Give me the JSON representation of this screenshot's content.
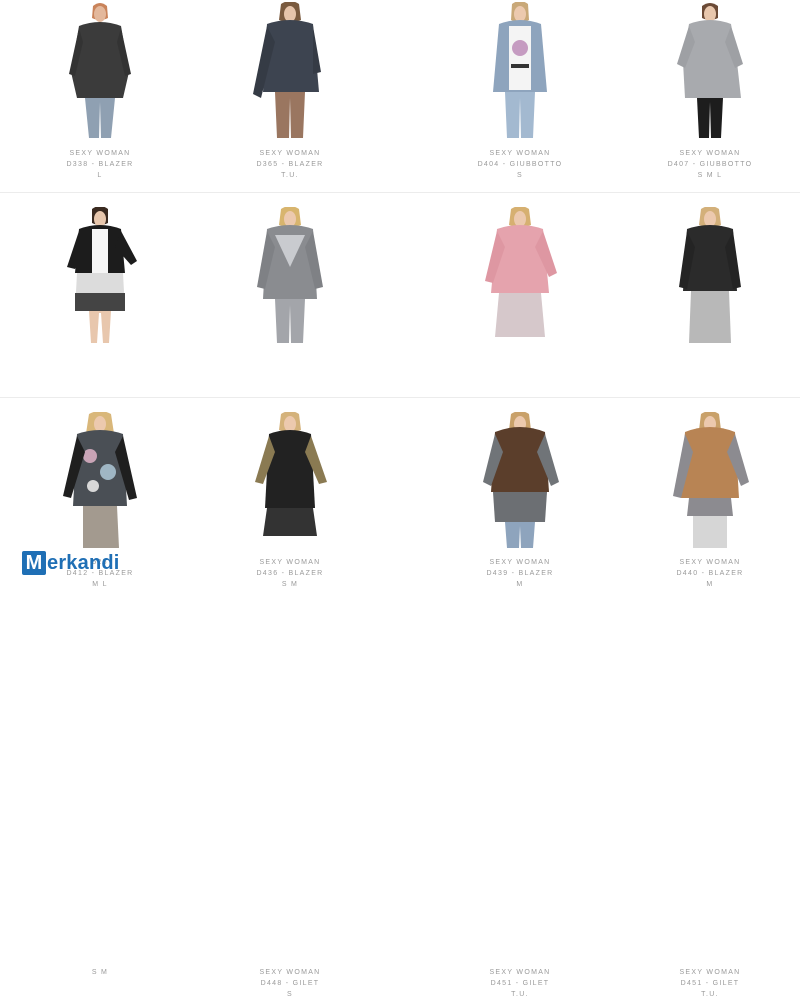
{
  "watermark": {
    "brand": "Merkandi"
  },
  "products": [
    {
      "brand": "SEXY WOMAN",
      "code": "D338 - BLAZER",
      "sizes": "L"
    },
    {
      "brand": "SEXY WOMAN",
      "code": "D365 - BLAZER",
      "sizes": "T.U."
    },
    {
      "brand": "SEXY WOMAN",
      "code": "D404 - GIUBBOTTO",
      "sizes": "S"
    },
    {
      "brand": "SEXY WOMAN",
      "code": "D407 - GIUBBOTTO",
      "sizes": "S M L"
    },
    {
      "brand": "525",
      "code": "D412 - BLAZER",
      "sizes": "M L"
    },
    {
      "brand": "SEXY WOMAN",
      "code": "D436 - BLAZER",
      "sizes": "S M"
    },
    {
      "brand": "SEXY WOMAN",
      "code": "D439 - BLAZER",
      "sizes": "M"
    },
    {
      "brand": "SEXY WOMAN",
      "code": "D440 - BLAZER",
      "sizes": "M"
    },
    {
      "brand": "",
      "code": "",
      "sizes": "S M"
    },
    {
      "brand": "SEXY WOMAN",
      "code": "D448 - GILET",
      "sizes": "S"
    },
    {
      "brand": "SEXY WOMAN",
      "code": "D451 - GILET",
      "sizes": "T.U."
    },
    {
      "brand": "SEXY WOMAN",
      "code": "D451 - GILET",
      "sizes": "T.U."
    }
  ],
  "colors": {
    "caption": "#9a9a9a",
    "watermark": "#1f6fb5"
  }
}
